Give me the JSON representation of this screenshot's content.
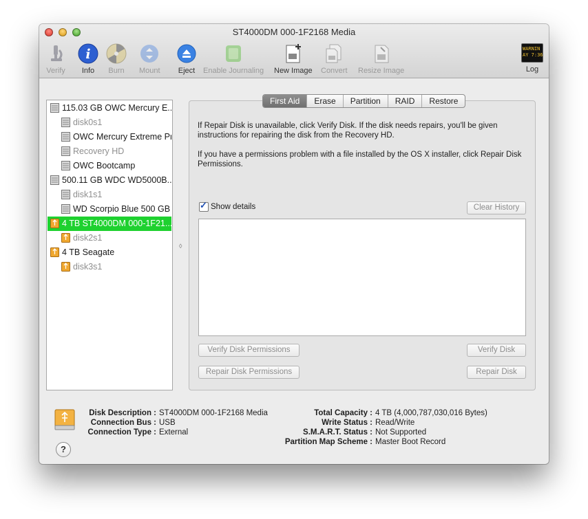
{
  "window": {
    "title": "ST4000DM 000-1F2168 Media"
  },
  "toolbar": {
    "items": [
      {
        "label": "Verify",
        "icon": "microscope-icon",
        "enabled": false
      },
      {
        "label": "Info",
        "icon": "info-icon",
        "enabled": true
      },
      {
        "label": "Burn",
        "icon": "burn-disc-icon",
        "enabled": false
      },
      {
        "label": "Mount",
        "icon": "mount-icon",
        "enabled": false
      },
      {
        "label": "Eject",
        "icon": "eject-icon",
        "enabled": true
      },
      {
        "label": "Enable Journaling",
        "icon": "journaling-icon",
        "enabled": false
      },
      {
        "label": "New Image",
        "icon": "new-image-icon",
        "enabled": true
      },
      {
        "label": "Convert",
        "icon": "convert-icon",
        "enabled": false
      },
      {
        "label": "Resize Image",
        "icon": "resize-image-icon",
        "enabled": false
      },
      {
        "label": "Log",
        "icon": "log-console-icon",
        "enabled": true
      }
    ],
    "log_icon_text": [
      "WARNIN",
      "AY 7:36"
    ]
  },
  "sidebar": {
    "items": [
      {
        "label": "115.03 GB OWC Mercury E...",
        "level": 0,
        "kind": "internal",
        "muted": false,
        "selected": false
      },
      {
        "label": "disk0s1",
        "level": 1,
        "kind": "internal",
        "muted": true,
        "selected": false
      },
      {
        "label": "OWC Mercury Extreme Pr",
        "level": 1,
        "kind": "internal",
        "muted": false,
        "selected": false
      },
      {
        "label": "Recovery HD",
        "level": 1,
        "kind": "internal",
        "muted": true,
        "selected": false
      },
      {
        "label": "OWC Bootcamp",
        "level": 1,
        "kind": "internal",
        "muted": false,
        "selected": false
      },
      {
        "label": "500.11 GB WDC WD5000B...",
        "level": 0,
        "kind": "internal",
        "muted": false,
        "selected": false
      },
      {
        "label": "disk1s1",
        "level": 1,
        "kind": "internal",
        "muted": true,
        "selected": false
      },
      {
        "label": "WD Scorpio Blue 500 GB",
        "level": 1,
        "kind": "internal",
        "muted": false,
        "selected": false
      },
      {
        "label": "4 TB ST4000DM 000-1F21...",
        "level": 0,
        "kind": "usb",
        "muted": false,
        "selected": true
      },
      {
        "label": "disk2s1",
        "level": 1,
        "kind": "usb",
        "muted": true,
        "selected": false
      },
      {
        "label": "4 TB Seagate",
        "level": 0,
        "kind": "usb",
        "muted": false,
        "selected": false
      },
      {
        "label": "disk3s1",
        "level": 1,
        "kind": "usb",
        "muted": true,
        "selected": false
      }
    ]
  },
  "tabs": [
    "First Aid",
    "Erase",
    "Partition",
    "RAID",
    "Restore"
  ],
  "active_tab": "First Aid",
  "first_aid": {
    "para1": "If Repair Disk is unavailable, click Verify Disk. If the disk needs repairs, you'll be given instructions for repairing the disk from the Recovery HD.",
    "para2": "If you have a permissions problem with a file installed by the OS X installer, click Repair Disk Permissions.",
    "show_details_label": "Show details",
    "show_details_checked": true,
    "clear_history": "Clear History",
    "verify_permissions": "Verify Disk Permissions",
    "repair_permissions": "Repair Disk Permissions",
    "verify_disk": "Verify Disk",
    "repair_disk": "Repair Disk"
  },
  "info": {
    "left": [
      {
        "label": "Disk Description :",
        "value": "ST4000DM 000-1F2168 Media"
      },
      {
        "label": "Connection Bus :",
        "value": "USB"
      },
      {
        "label": "Connection Type :",
        "value": "External"
      }
    ],
    "right": [
      {
        "label": "Total Capacity :",
        "value": "4 TB (4,000,787,030,016 Bytes)"
      },
      {
        "label": "Write Status :",
        "value": "Read/Write"
      },
      {
        "label": "S.M.A.R.T. Status :",
        "value": "Not Supported"
      },
      {
        "label": "Partition Map Scheme :",
        "value": "Master Boot Record"
      }
    ]
  },
  "help_label": "?",
  "colors": {
    "selection": "#1ed12f",
    "usb_drive": "#f0a830",
    "info_blue": "#2d5fd1"
  }
}
